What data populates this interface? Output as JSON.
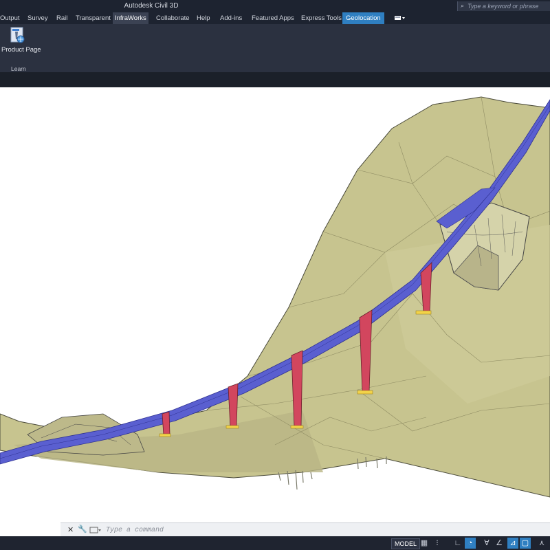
{
  "app": {
    "title": "Autodesk Civil 3D"
  },
  "search": {
    "placeholder": "Type a keyword or phrase"
  },
  "ribbon": {
    "tabs": [
      {
        "label": "Output"
      },
      {
        "label": "Survey"
      },
      {
        "label": "Rail"
      },
      {
        "label": "Transparent"
      },
      {
        "label": "InfraWorks"
      },
      {
        "label": "Collaborate"
      },
      {
        "label": "Help"
      },
      {
        "label": "Add-ins"
      },
      {
        "label": "Featured Apps"
      },
      {
        "label": "Express Tools"
      },
      {
        "label": "Geolocation"
      }
    ],
    "active_tab": "InfraWorks",
    "highlight_tab": "Geolocation",
    "button": {
      "label": "Product Page",
      "icon": "product-page-icon"
    },
    "panel_title": "Learn"
  },
  "command_line": {
    "placeholder": "Type a command"
  },
  "status_bar": {
    "model_label": "MODEL"
  },
  "colors": {
    "terrain": "#c7c48f",
    "road": "#5a5fd0",
    "piers": "#d2465e",
    "pier_base": "#f2d34a",
    "ribbon_bg": "#2b3140",
    "accent": "#2f7fc1"
  }
}
